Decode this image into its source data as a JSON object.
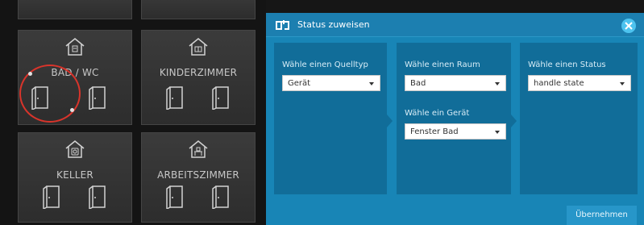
{
  "rooms": [
    {
      "name": "BAD / WC"
    },
    {
      "name": "KINDERZIMMER"
    },
    {
      "name": "KELLER"
    },
    {
      "name": "ARBEITSZIMMER"
    }
  ],
  "dialog": {
    "title": "Status zuweisen",
    "source_type": {
      "label": "Wähle einen Quelltyp",
      "value": "Gerät"
    },
    "room": {
      "label": "Wähle einen Raum",
      "value": "Bad"
    },
    "device": {
      "label": "Wähle ein Gerät",
      "value": "Fenster Bad"
    },
    "status": {
      "label": "Wähle einen Status",
      "value": "handle state"
    },
    "apply_label": "Übernehmen"
  },
  "colors": {
    "accent": "#1885b6",
    "panel": "#116d99",
    "marker": "#d9342b"
  },
  "icons": [
    "house-icon",
    "door-icon",
    "link-icon",
    "close-icon",
    "caret-down-icon"
  ]
}
